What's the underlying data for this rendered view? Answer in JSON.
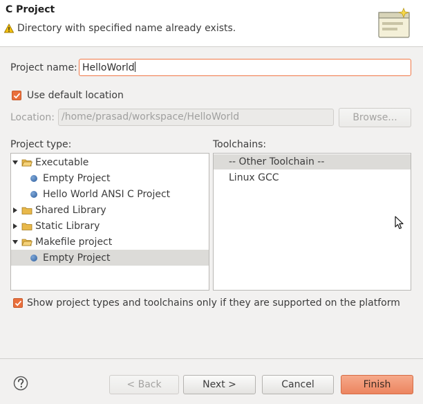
{
  "header": {
    "title": "C Project",
    "message": "Directory with specified name already exists."
  },
  "project_name": {
    "label": "Project name:",
    "value": "HelloWorld"
  },
  "use_default_location": {
    "label": "Use default location",
    "checked": true
  },
  "location": {
    "label": "Location:",
    "value": "/home/prasad/workspace/HelloWorld",
    "browse_label": "Browse..."
  },
  "project_type": {
    "label": "Project type:",
    "items": [
      {
        "label": "Executable",
        "kind": "folder",
        "expanded": true,
        "level": 0
      },
      {
        "label": "Empty Project",
        "kind": "leaf",
        "level": 1
      },
      {
        "label": "Hello World ANSI C Project",
        "kind": "leaf",
        "level": 1
      },
      {
        "label": "Shared Library",
        "kind": "folder",
        "expanded": false,
        "level": 0
      },
      {
        "label": "Static Library",
        "kind": "folder",
        "expanded": false,
        "level": 0
      },
      {
        "label": "Makefile project",
        "kind": "folder",
        "expanded": true,
        "level": 0
      },
      {
        "label": "Empty Project",
        "kind": "leaf",
        "level": 1,
        "selected": true
      }
    ]
  },
  "toolchains": {
    "label": "Toolchains:",
    "items": [
      {
        "label": "-- Other Toolchain --",
        "selected": true
      },
      {
        "label": "Linux GCC",
        "selected": false
      }
    ]
  },
  "show_supported": {
    "label": "Show project types and toolchains only if they are supported on the platform",
    "checked": true
  },
  "buttons": {
    "back": "< Back",
    "next": "Next >",
    "cancel": "Cancel",
    "finish": "Finish"
  },
  "colors": {
    "accent": "#e96f3c",
    "focus_border": "#f07746",
    "selection": "#dcdbd8",
    "background": "#f2f1f0"
  }
}
